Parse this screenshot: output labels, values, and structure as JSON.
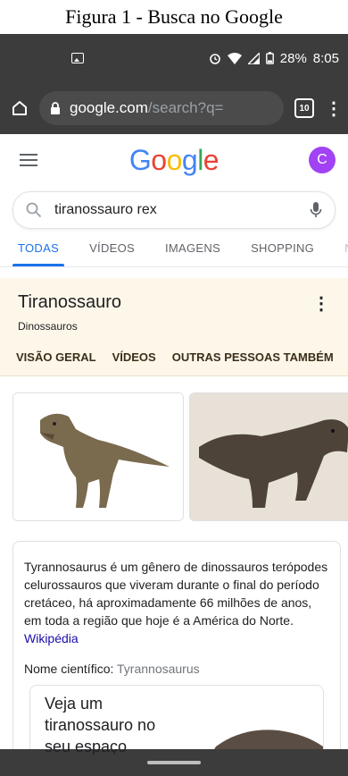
{
  "caption": "Figura 1 - Busca no Google",
  "status": {
    "battery": "28%",
    "time": "8:05"
  },
  "browser": {
    "url_host": "google.com",
    "url_path": "/search?q=",
    "tab_count": "10"
  },
  "google": {
    "logo_letters": [
      {
        "ch": "G",
        "color": "#4285f4"
      },
      {
        "ch": "o",
        "color": "#ea4335"
      },
      {
        "ch": "o",
        "color": "#fbbc05"
      },
      {
        "ch": "g",
        "color": "#4285f4"
      },
      {
        "ch": "l",
        "color": "#34a853"
      },
      {
        "ch": "e",
        "color": "#ea4335"
      }
    ],
    "avatar_letter": "C",
    "query": "tiranossauro rex",
    "tabs": [
      "TODAS",
      "VÍDEOS",
      "IMAGENS",
      "SHOPPING",
      "NO"
    ]
  },
  "panel": {
    "title": "Tiranossauro",
    "subtitle": "Dinossauros",
    "tabs": [
      "VISÃO GERAL",
      "VÍDEOS",
      "OUTRAS PESSOAS TAMBÉM"
    ]
  },
  "card": {
    "description": "Tyrannosaurus é um gênero de dinossauros terópodes celurossauros que viveram durante o final do período cretáceo, há aproximadamente 66 milhões de anos, em toda a região que hoje é a América do Norte.",
    "source": "Wikipédia",
    "sci_label": "Nome científico:",
    "sci_value": "Tyrannosaurus",
    "ar_text": "Veja um tiranossauro no seu espaço"
  },
  "colors": {
    "accent": "#1a73e8",
    "panel_bg": "#fdf7e9",
    "chrome_bg": "#3c3c3c"
  }
}
